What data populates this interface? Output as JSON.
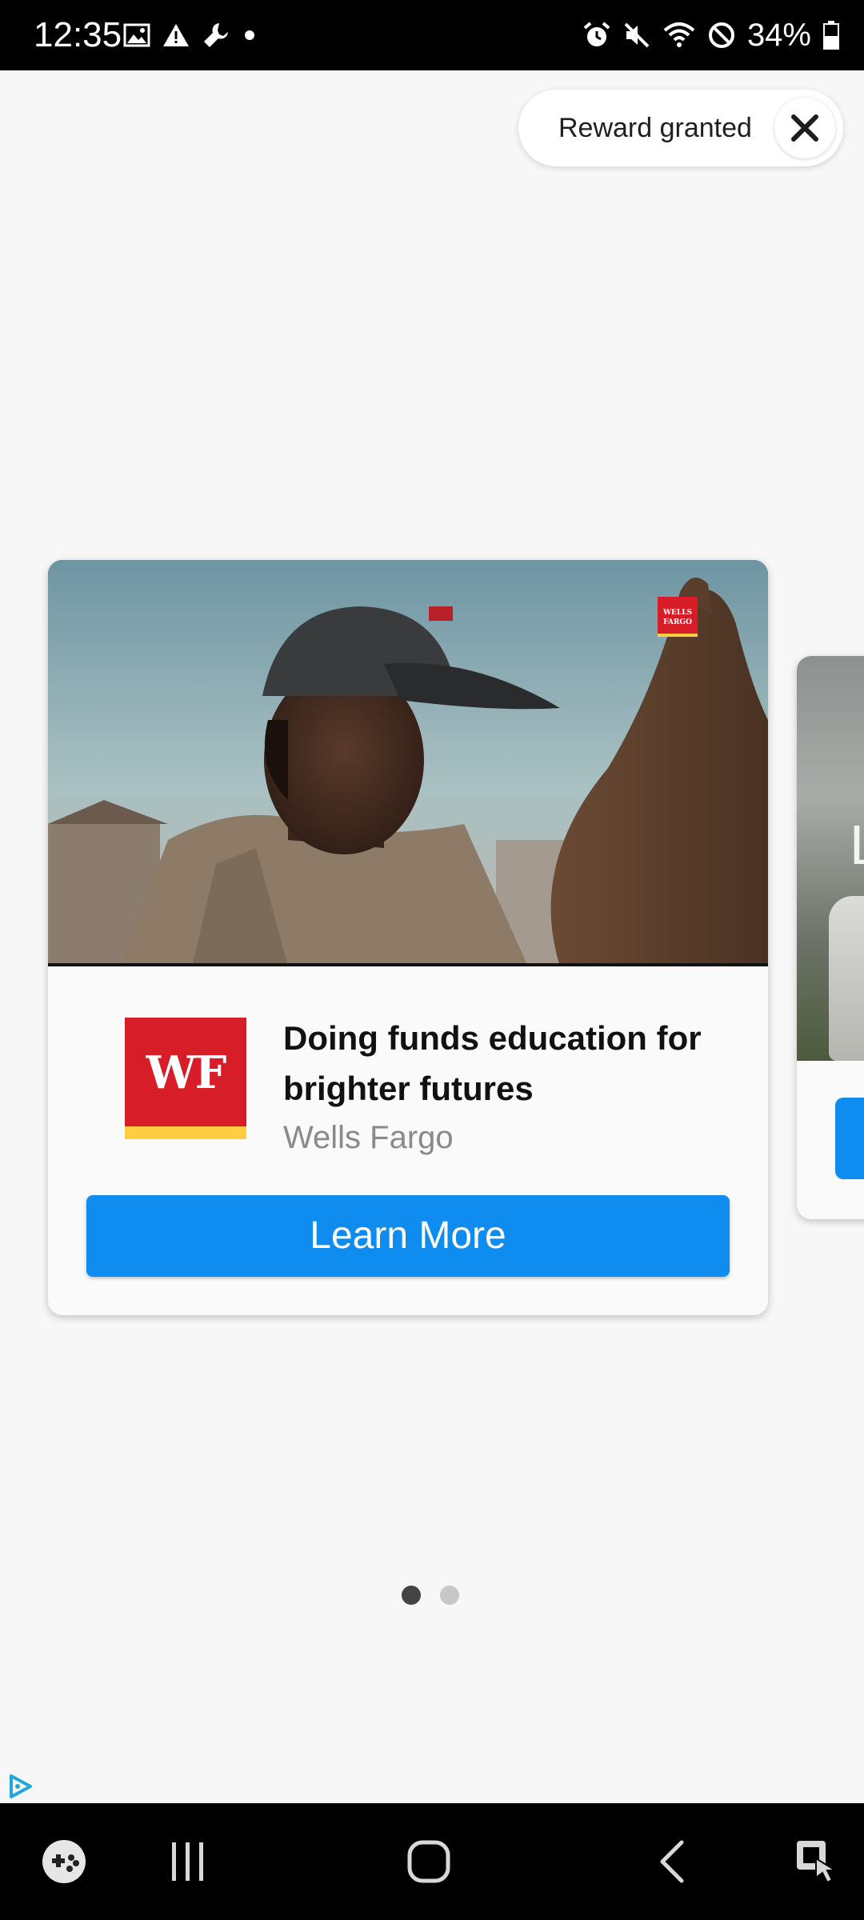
{
  "status_bar": {
    "time": "12:35",
    "battery_percent": "34%",
    "left_icons": [
      "image-icon",
      "warning-icon",
      "wrench-icon",
      "dot-icon"
    ],
    "right_icons": [
      "alarm-icon",
      "mute-icon",
      "wifi-icon",
      "do-not-disturb-icon",
      "battery-icon"
    ]
  },
  "reward": {
    "label": "Reward granted",
    "close_icon": "close-icon"
  },
  "ad": {
    "brand_logo_text": "WF",
    "media_logo_text": "WELLS FARGO",
    "headline": "Doing funds education for brighter futures",
    "advertiser": "Wells Fargo",
    "cta_label": "Learn More",
    "brand_color": "#d71e28",
    "brand_stripe_color": "#ffcd41",
    "cta_color": "#0f8cf0"
  },
  "peek_card": {
    "visible_text": "L"
  },
  "pager": {
    "total": 2,
    "active_index": 0
  },
  "nav_bar": {
    "items": [
      "game-launcher-icon",
      "recents-icon",
      "home-icon",
      "back-icon",
      "accessibility-icon"
    ]
  }
}
